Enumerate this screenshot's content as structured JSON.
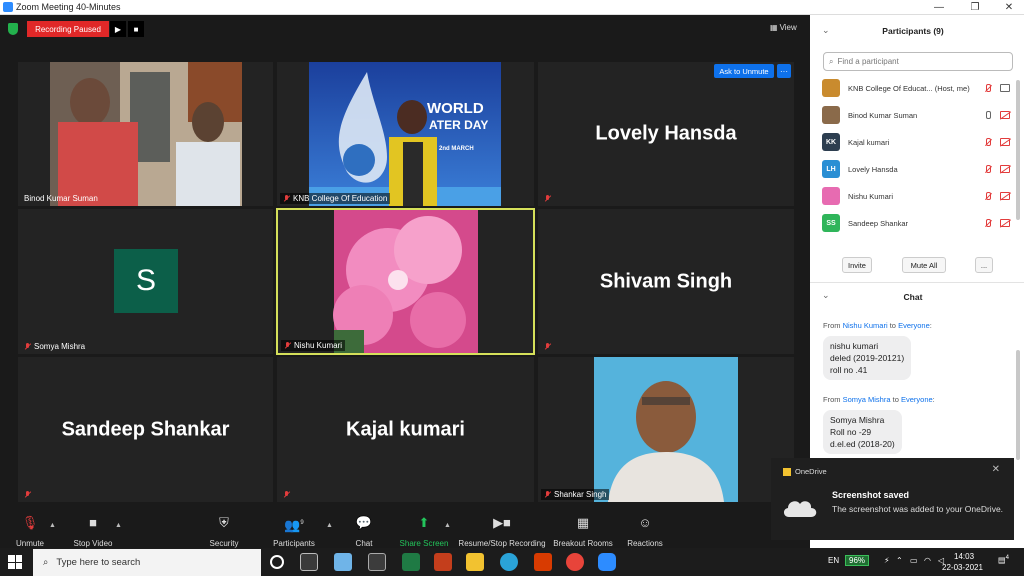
{
  "window": {
    "title": "Zoom Meeting 40-Minutes"
  },
  "recording": {
    "status": "Recording Paused",
    "play": "▶",
    "stop": "■"
  },
  "view": {
    "label": "View"
  },
  "tiles": [
    {
      "name": "Binod Kumar Suman",
      "type": "video"
    },
    {
      "name": "KNB College Of Education",
      "type": "video",
      "banner_line1": "WORLD",
      "banner_line2": "ATER DAY",
      "banner_line3": "2nd MARCH"
    },
    {
      "name": "Lovely Hansda",
      "type": "name"
    },
    {
      "name": "Somya Mishra",
      "type": "avatar",
      "initial": "S"
    },
    {
      "name": "Nishu Kumari",
      "type": "video"
    },
    {
      "name": "Shivam Singh",
      "type": "name"
    },
    {
      "name": "Sandeep Shankar",
      "type": "name"
    },
    {
      "name": "Kajal kumari",
      "type": "name"
    },
    {
      "name": "Shankar Singh",
      "type": "video"
    }
  ],
  "ask_unmute": {
    "label": "Ask to Unmute",
    "more": "···"
  },
  "toolbar": {
    "unmute": "Unmute",
    "stop_video": "Stop Video",
    "security": "Security",
    "participants": "Participants",
    "participants_count": "9",
    "chat": "Chat",
    "share_screen": "Share Screen",
    "record": "Resume/Stop Recording",
    "breakout": "Breakout Rooms",
    "reactions": "Reactions"
  },
  "participants_panel": {
    "title": "Participants (9)",
    "search_placeholder": "Find a participant",
    "list": [
      {
        "name": "KNB College Of Educat... (Host, me)",
        "initials": "",
        "color": "#c98b2e",
        "mic": "off",
        "cam": "on"
      },
      {
        "name": "Binod Kumar Suman",
        "initials": "",
        "color": "#8a6a4a",
        "mic": "on",
        "cam": "off"
      },
      {
        "name": "Kajal kumari",
        "initials": "KK",
        "color": "#2d3e50",
        "mic": "off",
        "cam": "off"
      },
      {
        "name": "Lovely Hansda",
        "initials": "LH",
        "color": "#2a8fd4",
        "mic": "off",
        "cam": "off"
      },
      {
        "name": "Nishu Kumari",
        "initials": "",
        "color": "#e76bb1",
        "mic": "off",
        "cam": "off"
      },
      {
        "name": "Sandeep Shankar",
        "initials": "SS",
        "color": "#2fb55a",
        "mic": "off",
        "cam": "off"
      }
    ],
    "invite": "Invite",
    "mute_all": "Mute All",
    "more": "..."
  },
  "chat_panel": {
    "title": "Chat",
    "messages": [
      {
        "from_label": "From",
        "from": "Nishu Kumari",
        "to_label": "to",
        "to": "Everyone",
        "colon": ":",
        "lines": [
          "nishu kumari",
          "deled (2019-20121)",
          "roll no .41"
        ]
      },
      {
        "from_label": "From",
        "from": "Somya Mishra",
        "to_label": "to",
        "to": "Everyone",
        "colon": ":",
        "lines": [
          "Somya Mishra",
          "Roll no -29",
          "d.el.ed (2018-20)"
        ]
      }
    ]
  },
  "toast": {
    "app": "OneDrive",
    "title": "Screenshot saved",
    "body": "The screenshot was added to your OneDrive.",
    "close": "✕"
  },
  "taskbar": {
    "search_placeholder": "Type here to search",
    "battery": "96%",
    "lang": "EN",
    "time": "14:03",
    "date": "22-03-2021",
    "notifications": "4"
  }
}
